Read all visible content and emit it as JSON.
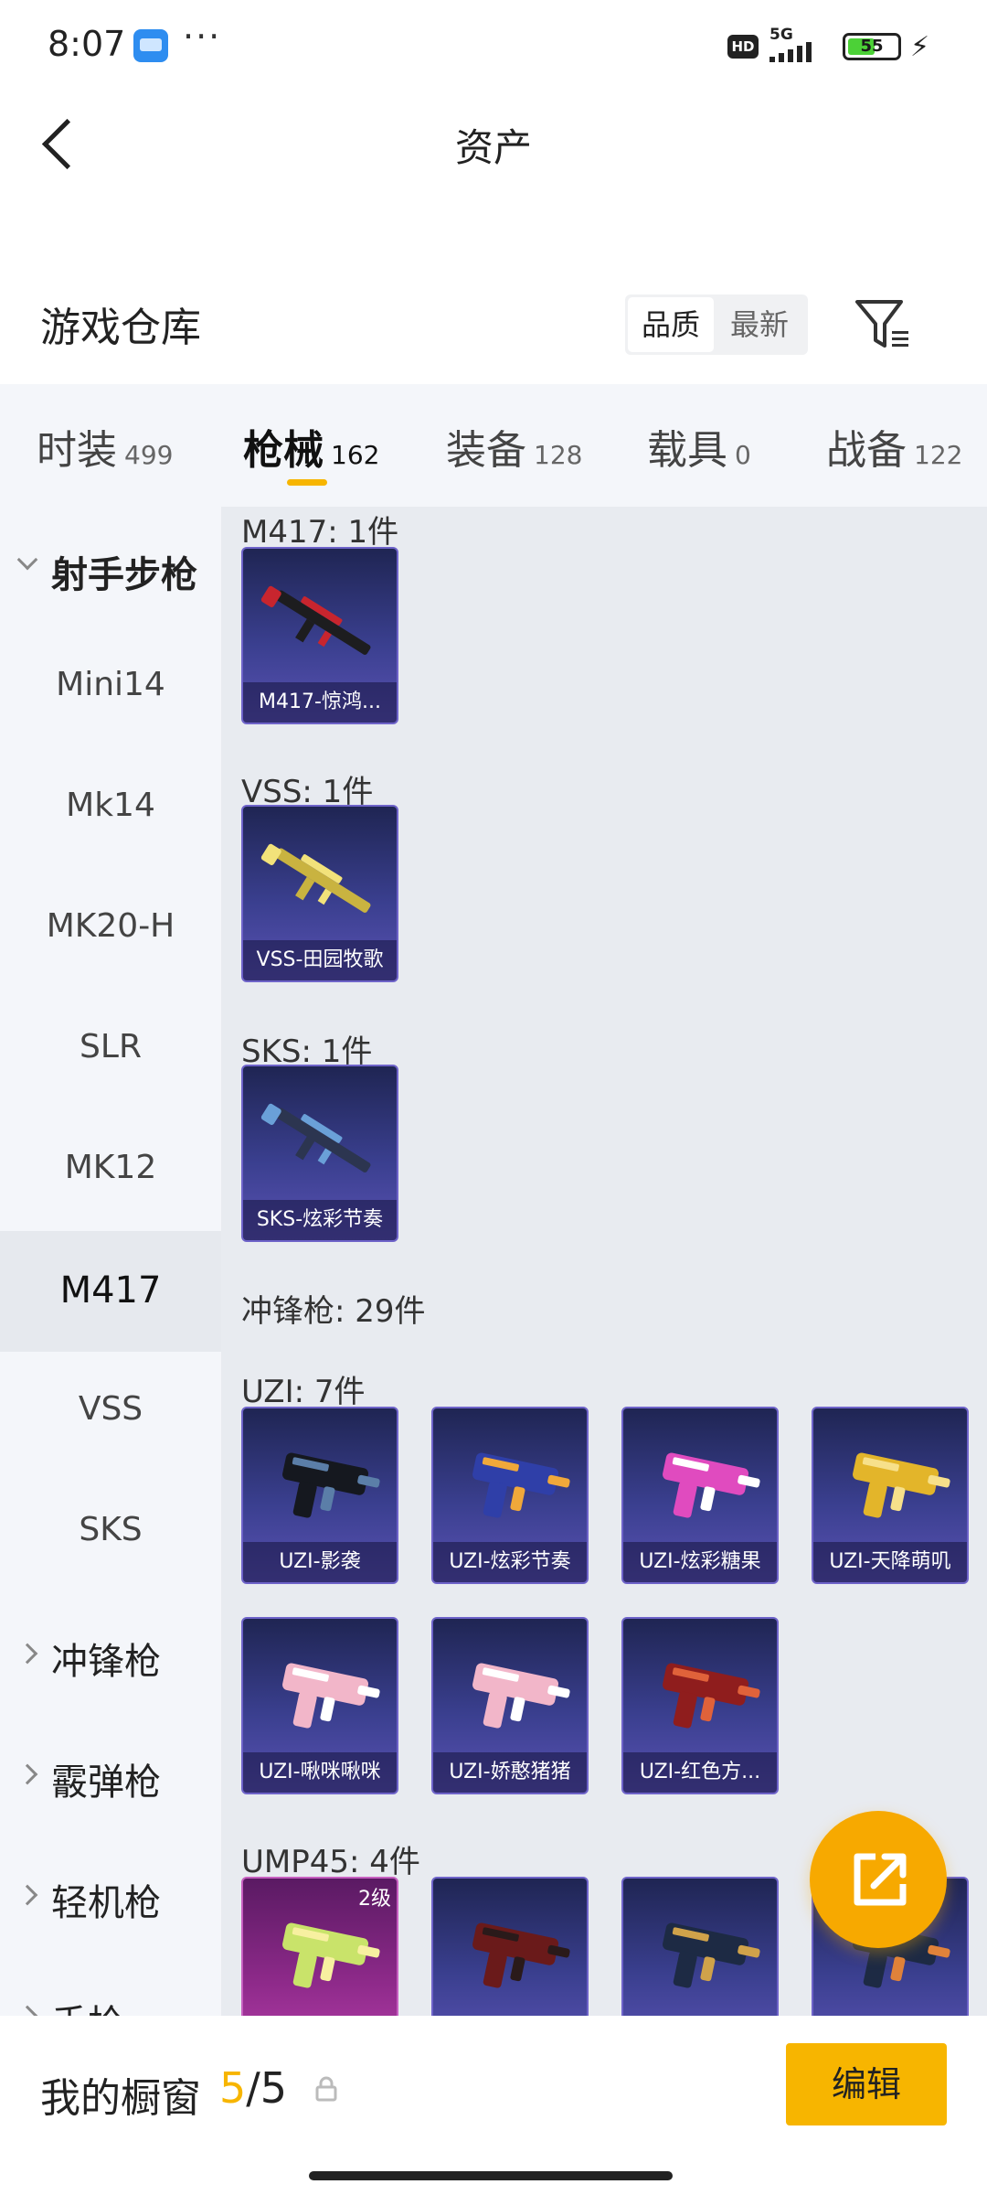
{
  "status_bar": {
    "time": "8:07",
    "dots": "···",
    "hd": "HD",
    "network": "5G",
    "battery": "55",
    "battery_level": 0.55
  },
  "header": {
    "title": "资产"
  },
  "warehouse": {
    "title": "游戏仓库",
    "sort_options": [
      "品质",
      "最新"
    ],
    "active_sort": "品质"
  },
  "tabs": [
    {
      "label": "时装",
      "count": "499"
    },
    {
      "label": "枪械",
      "count": "162",
      "active": true
    },
    {
      "label": "装备",
      "count": "128"
    },
    {
      "label": "载具",
      "count": "0"
    },
    {
      "label": "战备",
      "count": "122"
    }
  ],
  "sidebar": {
    "items": [
      {
        "label": "射手步枪",
        "type": "group",
        "expanded": true
      },
      {
        "label": "Mini14"
      },
      {
        "label": "Mk14"
      },
      {
        "label": "MK20-H"
      },
      {
        "label": "SLR"
      },
      {
        "label": "MK12"
      },
      {
        "label": "M417",
        "selected": true
      },
      {
        "label": "VSS"
      },
      {
        "label": "SKS"
      },
      {
        "label": "冲锋枪",
        "type": "group"
      },
      {
        "label": "霰弹枪",
        "type": "group"
      },
      {
        "label": "轻机枪",
        "type": "group"
      },
      {
        "label": "手枪",
        "type": "group"
      }
    ]
  },
  "content": {
    "sections": [
      {
        "heading": "M417: 1件",
        "cards": [
          {
            "name": "M417-惊鸿...",
            "icon": "rifle-red-black"
          }
        ]
      },
      {
        "heading": "VSS: 1件",
        "cards": [
          {
            "name": "VSS-田园牧歌",
            "icon": "rifle-gold"
          }
        ]
      },
      {
        "heading": "SKS: 1件",
        "cards": [
          {
            "name": "SKS-炫彩节奏",
            "icon": "rifle-blue"
          }
        ]
      },
      {
        "heading": "冲锋枪: 29件",
        "cards": []
      },
      {
        "heading": "UZI: 7件",
        "cards": [
          {
            "name": "UZI-影袭",
            "icon": "smg-dark"
          },
          {
            "name": "UZI-炫彩节奏",
            "icon": "smg-blue"
          },
          {
            "name": "UZI-炫彩糖果",
            "icon": "smg-pink"
          },
          {
            "name": "UZI-天降萌叽",
            "icon": "smg-yellow"
          },
          {
            "name": "UZI-啾咪啾咪",
            "icon": "smg-lightpink"
          },
          {
            "name": "UZI-娇憨猪猪",
            "icon": "smg-lightpink"
          },
          {
            "name": "UZI-红色方...",
            "icon": "smg-red"
          }
        ]
      },
      {
        "heading": "UMP45: 4件",
        "cards": [
          {
            "name": "",
            "icon": "smg-lime",
            "tag": "2级",
            "tier": "purple"
          },
          {
            "name": "",
            "icon": "smg-red-dark"
          },
          {
            "name": "",
            "icon": "smg-blue-dark"
          },
          {
            "name": "",
            "icon": "smg-orange-dark"
          }
        ]
      }
    ]
  },
  "bottom_bar": {
    "label": "我的橱窗",
    "used": "5",
    "separator": "/",
    "total": "5",
    "edit_label": "编辑"
  },
  "colors": {
    "accent": "#f7b500",
    "card_bg": "#3a3f8f",
    "sidebar_bg": "#f4f6fa",
    "content_bg": "#e8ebf0"
  }
}
